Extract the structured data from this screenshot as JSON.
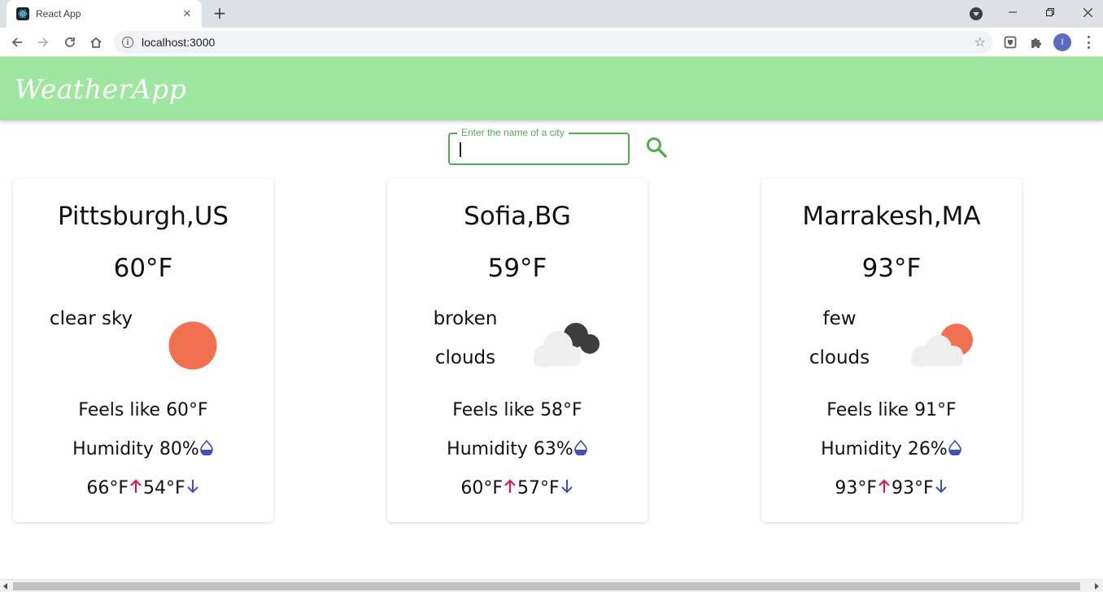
{
  "browser": {
    "tab_title": "React App",
    "url": "localhost:3000",
    "profile_initial": "I"
  },
  "app": {
    "title": "WeatherApp",
    "search": {
      "label": "Enter the name of a city",
      "value": ""
    },
    "colors": {
      "header_bg": "#9fe6a0",
      "accent": "#4caf50",
      "sun": "#f07050",
      "arrow_up": "#e0135f",
      "arrow_down": "#3f51b5"
    },
    "cards": [
      {
        "city": "Pittsburgh,US",
        "temp": "60°F",
        "description": "clear sky",
        "icon": "clear-sky-icon",
        "feels_like": "Feels like 60°F",
        "humidity": "Humidity 80%",
        "max": "66°F",
        "min": "54°F"
      },
      {
        "city": "Sofia,BG",
        "temp": "59°F",
        "description_line1": "broken",
        "description_line2": "clouds",
        "icon": "broken-clouds-icon",
        "feels_like": "Feels like 58°F",
        "humidity": "Humidity 63%",
        "max": "60°F",
        "min": "57°F"
      },
      {
        "city": "Marrakesh,MA",
        "temp": "93°F",
        "description_line1": "few",
        "description_line2": "clouds",
        "icon": "few-clouds-icon",
        "feels_like": "Feels like 91°F",
        "humidity": "Humidity 26%",
        "max": "93°F",
        "min": "93°F"
      }
    ]
  }
}
